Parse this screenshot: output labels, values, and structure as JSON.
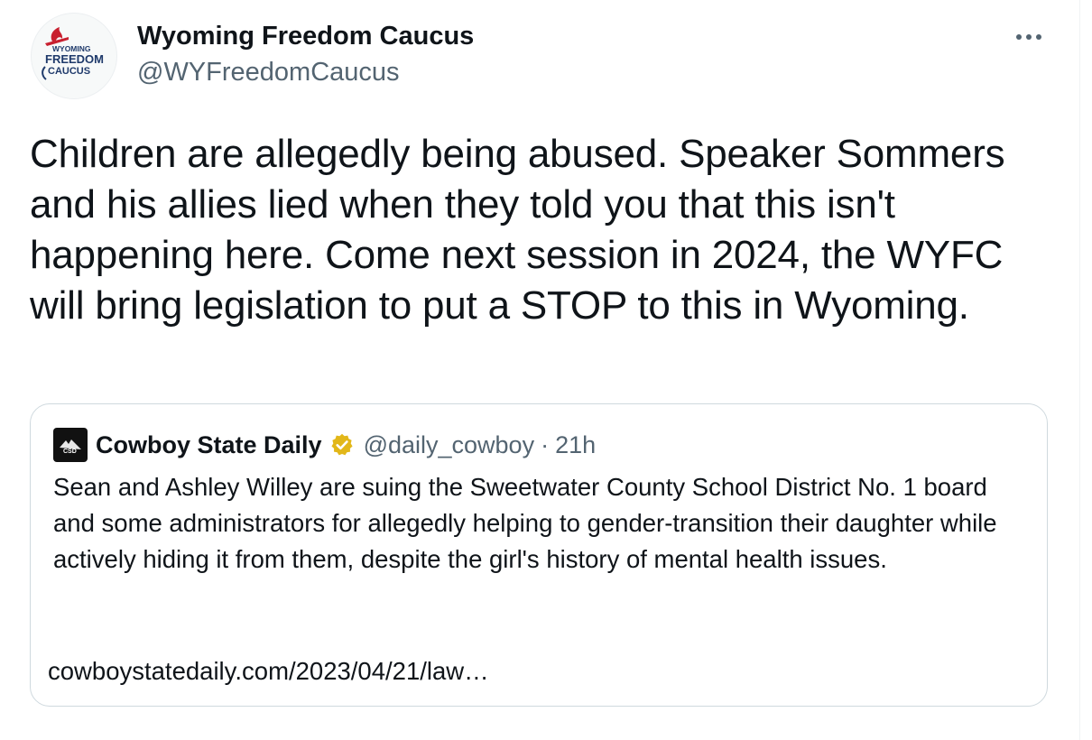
{
  "tweet": {
    "author_name": "Wyoming Freedom Caucus",
    "author_handle": "@WYFreedomCaucus",
    "avatar_text_line1": "WYOMING",
    "avatar_text_line2": "FREEDOM",
    "avatar_text_line3": "CAUCUS",
    "more_icon": "ellipsis-icon",
    "text": "Children are allegedly being abused. Speaker Sommers and his allies lied when they told you that this isn't happening here. Come next session in 2024, the WYFC will bring legislation to put a STOP to this in Wyoming."
  },
  "quote": {
    "author_name": "Cowboy State Daily",
    "verified_icon": "verified-badge-icon",
    "verified_color": "#e2b719",
    "author_handle": "@daily_cowboy",
    "separator": "·",
    "time": "21h",
    "avatar_text": "CSD",
    "text": "Sean and Ashley Willey are suing the Sweetwater County School District No. 1 board and some administrators for allegedly helping to gender-transition their daughter while actively hiding it from them, despite the girl's history of mental health issues.",
    "link": "cowboystatedaily.com/2023/04/21/law…"
  },
  "colors": {
    "text_primary": "#0f1419",
    "text_secondary": "#536471",
    "border": "#cfd9de",
    "brand_red": "#c8202f",
    "brand_blue": "#1f3a6b"
  }
}
